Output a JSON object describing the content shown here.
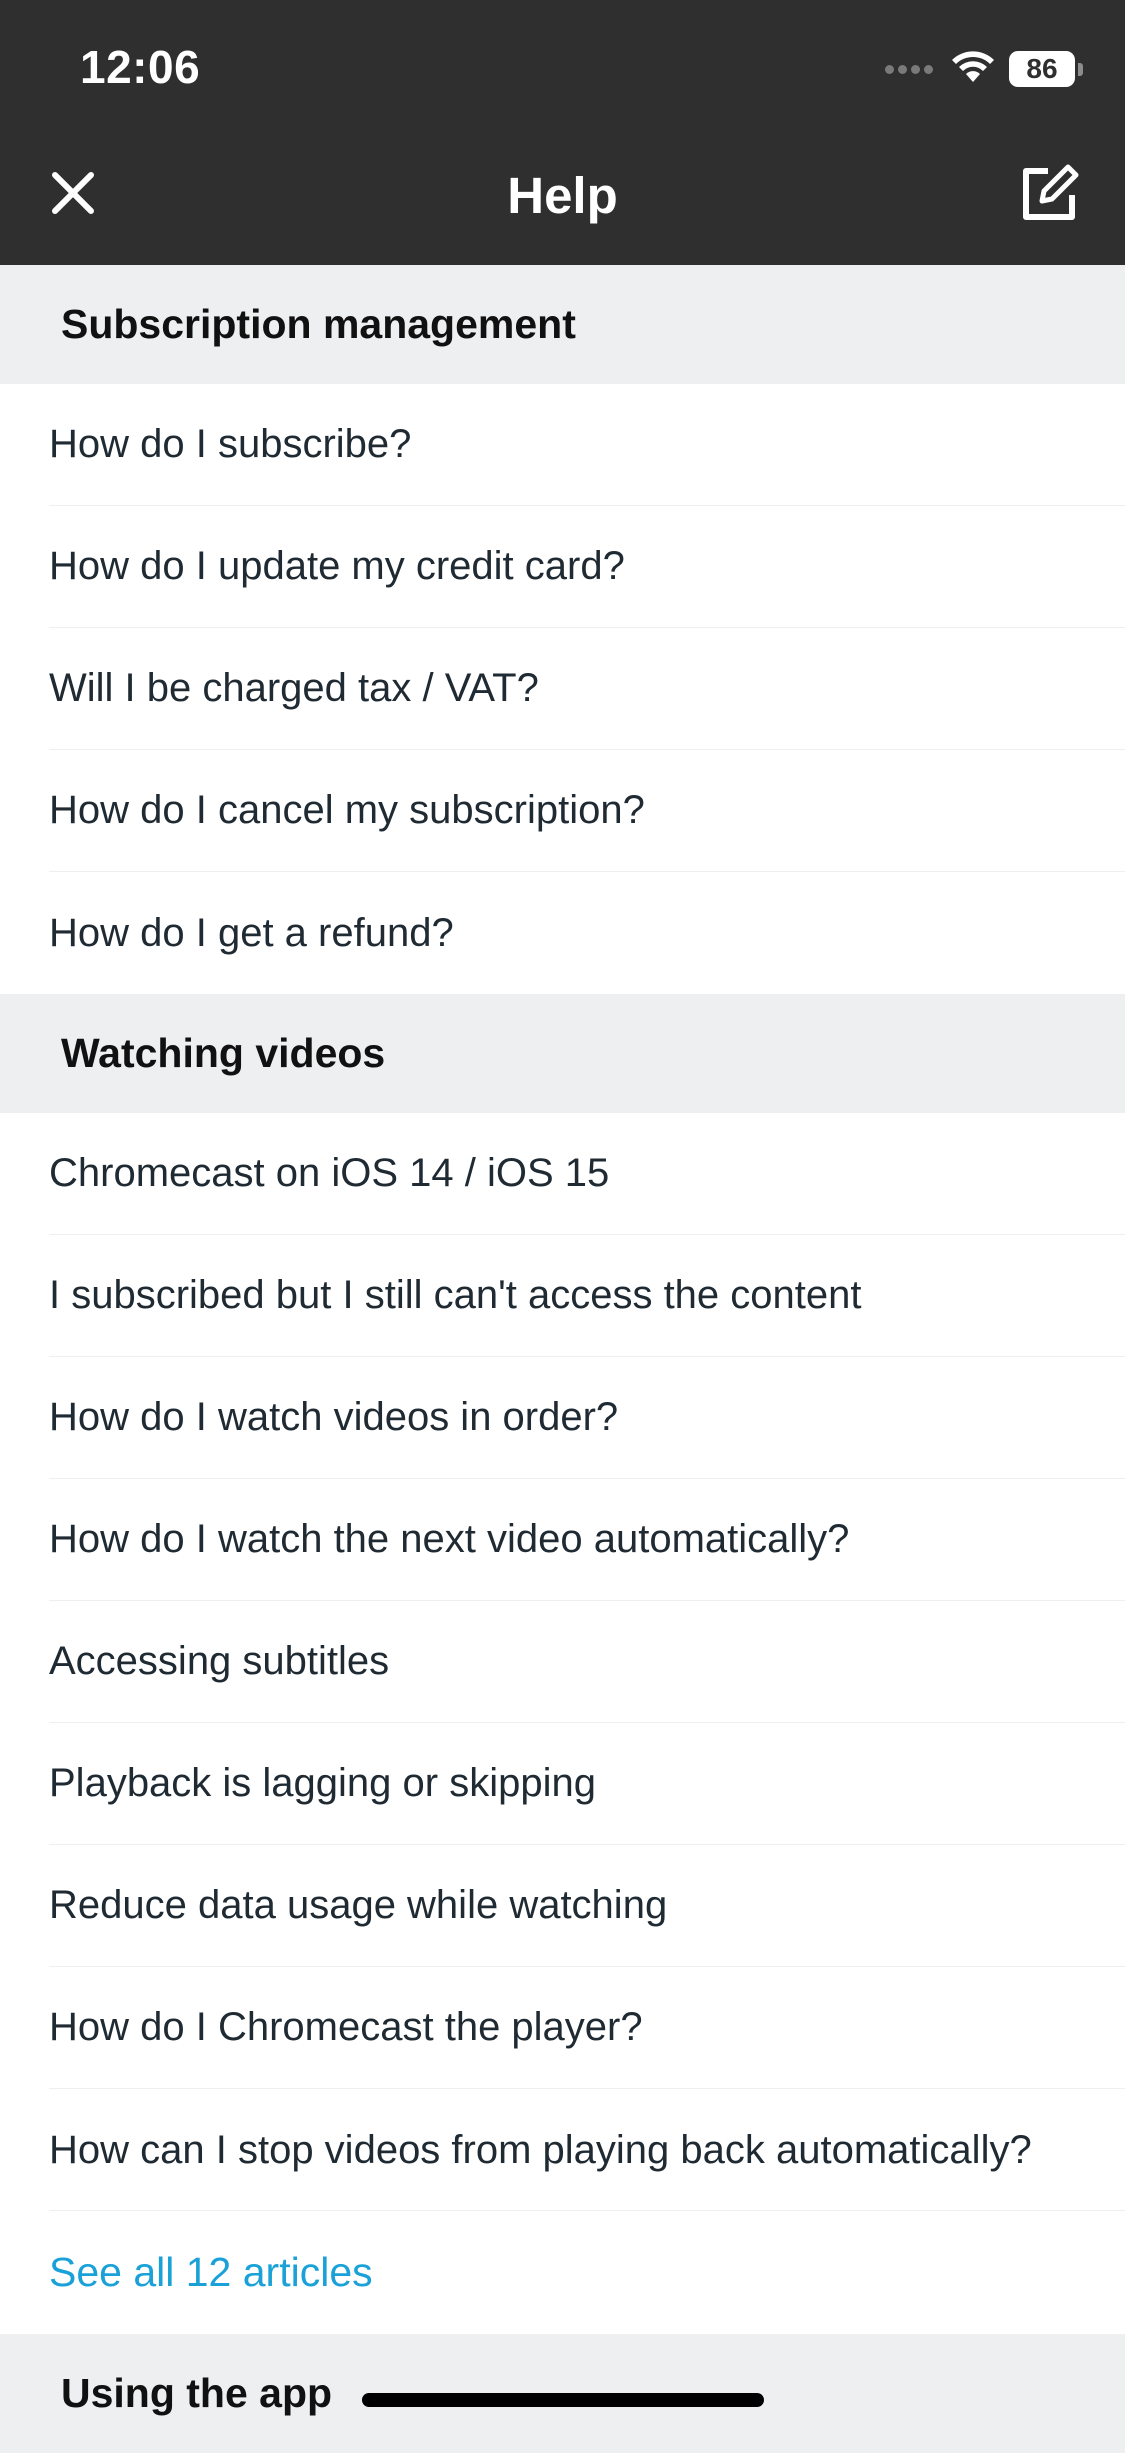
{
  "status_bar": {
    "time": "12:06",
    "battery": "86"
  },
  "nav": {
    "title": "Help",
    "close_icon": "close-icon",
    "compose_icon": "compose-icon"
  },
  "sections": [
    {
      "title": "Subscription management",
      "items": [
        "How do I subscribe?",
        "How do I update my credit card?",
        "Will I be charged tax / VAT?",
        "How do I cancel my subscription?",
        "How do I get a refund?"
      ]
    },
    {
      "title": "Watching videos",
      "items": [
        "Chromecast on iOS 14 / iOS 15",
        "I subscribed but I still can't access the content",
        "How do I watch videos in order?",
        "How do I watch the next video automatically?",
        "Accessing subtitles",
        "Playback is lagging or skipping",
        "Reduce data usage while watching",
        "How do I Chromecast the player?",
        "How can I stop videos from playing back automatically?"
      ],
      "see_all": "See all 12 articles"
    },
    {
      "title": "Using the app"
    }
  ],
  "colors": {
    "topbar": "#2f2f2f",
    "section_bg": "#eeeff1",
    "link": "#1aa2d8"
  }
}
